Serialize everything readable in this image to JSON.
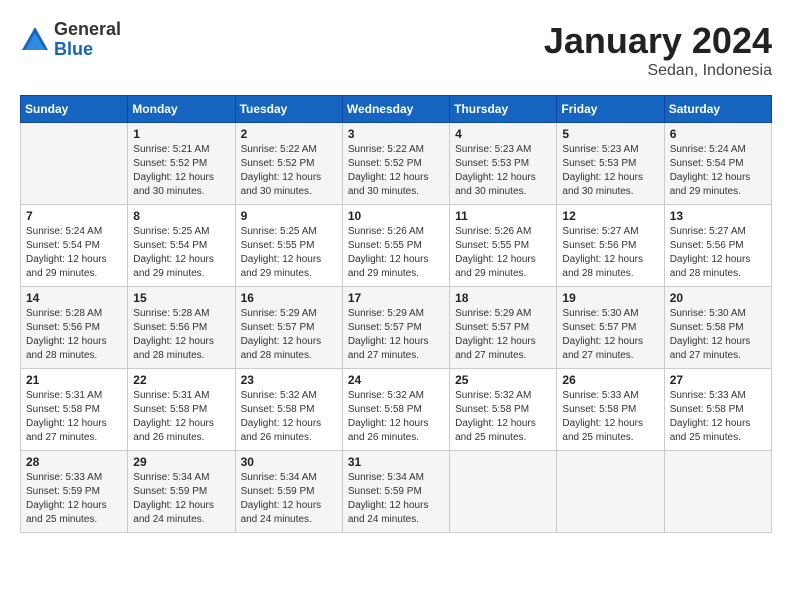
{
  "header": {
    "logo_general": "General",
    "logo_blue": "Blue",
    "month_year": "January 2024",
    "location": "Sedan, Indonesia"
  },
  "days_of_week": [
    "Sunday",
    "Monday",
    "Tuesday",
    "Wednesday",
    "Thursday",
    "Friday",
    "Saturday"
  ],
  "weeks": [
    [
      {
        "day": "",
        "sunrise": "",
        "sunset": "",
        "daylight": ""
      },
      {
        "day": "1",
        "sunrise": "Sunrise: 5:21 AM",
        "sunset": "Sunset: 5:52 PM",
        "daylight": "Daylight: 12 hours and 30 minutes."
      },
      {
        "day": "2",
        "sunrise": "Sunrise: 5:22 AM",
        "sunset": "Sunset: 5:52 PM",
        "daylight": "Daylight: 12 hours and 30 minutes."
      },
      {
        "day": "3",
        "sunrise": "Sunrise: 5:22 AM",
        "sunset": "Sunset: 5:52 PM",
        "daylight": "Daylight: 12 hours and 30 minutes."
      },
      {
        "day": "4",
        "sunrise": "Sunrise: 5:23 AM",
        "sunset": "Sunset: 5:53 PM",
        "daylight": "Daylight: 12 hours and 30 minutes."
      },
      {
        "day": "5",
        "sunrise": "Sunrise: 5:23 AM",
        "sunset": "Sunset: 5:53 PM",
        "daylight": "Daylight: 12 hours and 30 minutes."
      },
      {
        "day": "6",
        "sunrise": "Sunrise: 5:24 AM",
        "sunset": "Sunset: 5:54 PM",
        "daylight": "Daylight: 12 hours and 29 minutes."
      }
    ],
    [
      {
        "day": "7",
        "sunrise": "Sunrise: 5:24 AM",
        "sunset": "Sunset: 5:54 PM",
        "daylight": "Daylight: 12 hours and 29 minutes."
      },
      {
        "day": "8",
        "sunrise": "Sunrise: 5:25 AM",
        "sunset": "Sunset: 5:54 PM",
        "daylight": "Daylight: 12 hours and 29 minutes."
      },
      {
        "day": "9",
        "sunrise": "Sunrise: 5:25 AM",
        "sunset": "Sunset: 5:55 PM",
        "daylight": "Daylight: 12 hours and 29 minutes."
      },
      {
        "day": "10",
        "sunrise": "Sunrise: 5:26 AM",
        "sunset": "Sunset: 5:55 PM",
        "daylight": "Daylight: 12 hours and 29 minutes."
      },
      {
        "day": "11",
        "sunrise": "Sunrise: 5:26 AM",
        "sunset": "Sunset: 5:55 PM",
        "daylight": "Daylight: 12 hours and 29 minutes."
      },
      {
        "day": "12",
        "sunrise": "Sunrise: 5:27 AM",
        "sunset": "Sunset: 5:56 PM",
        "daylight": "Daylight: 12 hours and 28 minutes."
      },
      {
        "day": "13",
        "sunrise": "Sunrise: 5:27 AM",
        "sunset": "Sunset: 5:56 PM",
        "daylight": "Daylight: 12 hours and 28 minutes."
      }
    ],
    [
      {
        "day": "14",
        "sunrise": "Sunrise: 5:28 AM",
        "sunset": "Sunset: 5:56 PM",
        "daylight": "Daylight: 12 hours and 28 minutes."
      },
      {
        "day": "15",
        "sunrise": "Sunrise: 5:28 AM",
        "sunset": "Sunset: 5:56 PM",
        "daylight": "Daylight: 12 hours and 28 minutes."
      },
      {
        "day": "16",
        "sunrise": "Sunrise: 5:29 AM",
        "sunset": "Sunset: 5:57 PM",
        "daylight": "Daylight: 12 hours and 28 minutes."
      },
      {
        "day": "17",
        "sunrise": "Sunrise: 5:29 AM",
        "sunset": "Sunset: 5:57 PM",
        "daylight": "Daylight: 12 hours and 27 minutes."
      },
      {
        "day": "18",
        "sunrise": "Sunrise: 5:29 AM",
        "sunset": "Sunset: 5:57 PM",
        "daylight": "Daylight: 12 hours and 27 minutes."
      },
      {
        "day": "19",
        "sunrise": "Sunrise: 5:30 AM",
        "sunset": "Sunset: 5:57 PM",
        "daylight": "Daylight: 12 hours and 27 minutes."
      },
      {
        "day": "20",
        "sunrise": "Sunrise: 5:30 AM",
        "sunset": "Sunset: 5:58 PM",
        "daylight": "Daylight: 12 hours and 27 minutes."
      }
    ],
    [
      {
        "day": "21",
        "sunrise": "Sunrise: 5:31 AM",
        "sunset": "Sunset: 5:58 PM",
        "daylight": "Daylight: 12 hours and 27 minutes."
      },
      {
        "day": "22",
        "sunrise": "Sunrise: 5:31 AM",
        "sunset": "Sunset: 5:58 PM",
        "daylight": "Daylight: 12 hours and 26 minutes."
      },
      {
        "day": "23",
        "sunrise": "Sunrise: 5:32 AM",
        "sunset": "Sunset: 5:58 PM",
        "daylight": "Daylight: 12 hours and 26 minutes."
      },
      {
        "day": "24",
        "sunrise": "Sunrise: 5:32 AM",
        "sunset": "Sunset: 5:58 PM",
        "daylight": "Daylight: 12 hours and 26 minutes."
      },
      {
        "day": "25",
        "sunrise": "Sunrise: 5:32 AM",
        "sunset": "Sunset: 5:58 PM",
        "daylight": "Daylight: 12 hours and 25 minutes."
      },
      {
        "day": "26",
        "sunrise": "Sunrise: 5:33 AM",
        "sunset": "Sunset: 5:58 PM",
        "daylight": "Daylight: 12 hours and 25 minutes."
      },
      {
        "day": "27",
        "sunrise": "Sunrise: 5:33 AM",
        "sunset": "Sunset: 5:58 PM",
        "daylight": "Daylight: 12 hours and 25 minutes."
      }
    ],
    [
      {
        "day": "28",
        "sunrise": "Sunrise: 5:33 AM",
        "sunset": "Sunset: 5:59 PM",
        "daylight": "Daylight: 12 hours and 25 minutes."
      },
      {
        "day": "29",
        "sunrise": "Sunrise: 5:34 AM",
        "sunset": "Sunset: 5:59 PM",
        "daylight": "Daylight: 12 hours and 24 minutes."
      },
      {
        "day": "30",
        "sunrise": "Sunrise: 5:34 AM",
        "sunset": "Sunset: 5:59 PM",
        "daylight": "Daylight: 12 hours and 24 minutes."
      },
      {
        "day": "31",
        "sunrise": "Sunrise: 5:34 AM",
        "sunset": "Sunset: 5:59 PM",
        "daylight": "Daylight: 12 hours and 24 minutes."
      },
      {
        "day": "",
        "sunrise": "",
        "sunset": "",
        "daylight": ""
      },
      {
        "day": "",
        "sunrise": "",
        "sunset": "",
        "daylight": ""
      },
      {
        "day": "",
        "sunrise": "",
        "sunset": "",
        "daylight": ""
      }
    ]
  ]
}
